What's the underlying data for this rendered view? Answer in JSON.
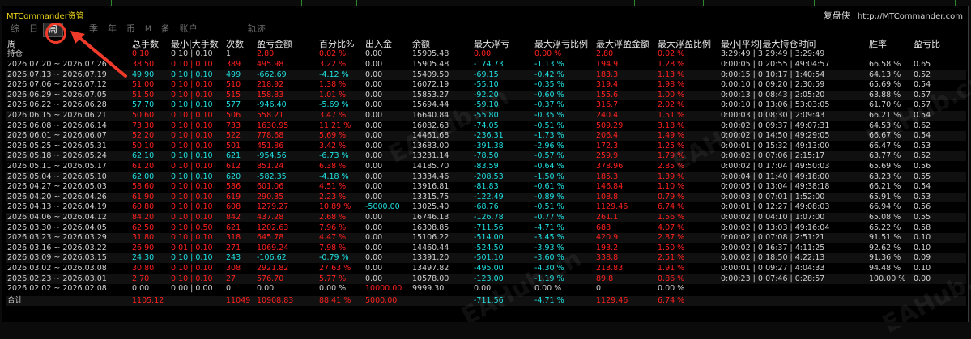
{
  "app": {
    "title": "MTCommander资管",
    "brand_cn": "复盘侠",
    "brand_url": "http://MTCommander.com"
  },
  "tabs": [
    {
      "label": "综",
      "active": false
    },
    {
      "label": "日",
      "active": false
    },
    {
      "label": "周",
      "active": true
    },
    {
      "label": "季",
      "active": false
    },
    {
      "label": "年",
      "active": false
    },
    {
      "label": "币",
      "active": false
    },
    {
      "label": "M",
      "active": false
    },
    {
      "label": "备",
      "active": false
    },
    {
      "label": "账户",
      "active": false
    },
    {
      "label": "轨迹",
      "active": false
    }
  ],
  "columns": [
    "周",
    "总手数",
    "最小|大手数",
    "次数",
    "盈亏金额",
    "百分比%",
    "出入金",
    "余额",
    "最大浮亏",
    "最大浮亏比例",
    "最大浮盈金额",
    "最大浮盈比例",
    "最小|平均|最大持仓时间",
    "胜率",
    "盈亏比"
  ],
  "holding_row": [
    "持仓",
    "0.10",
    "0.10 | 0.10",
    "1",
    "2.80",
    "0.02 %",
    "0.00",
    "15905.48",
    "0.00",
    "0.00 %",
    "2.80",
    "0.02 %",
    "3:29:49 | 3:29:49 | 3:29:49",
    "",
    ""
  ],
  "rows": [
    [
      "2026.07.20 ~ 2026.07.26",
      "38.50",
      "0.10 | 0.10",
      "389",
      "495.98",
      "3.22 %",
      "0.00",
      "15905.48",
      "-174.73",
      "-1.13 %",
      "194.9",
      "1.28 %",
      "0:00:05 | 0:20:55 | 49:04:57",
      "66.58 %",
      "0.65"
    ],
    [
      "2026.07.13 ~ 2026.07.19",
      "49.90",
      "0.10 | 0.10",
      "499",
      "-662.69",
      "-4.12 %",
      "0.00",
      "15409.50",
      "-69.15",
      "-0.42 %",
      "183.3",
      "1.13 %",
      "0:00:15 | 0:10:17 | 1:40:54",
      "64.13 %",
      "0.52"
    ],
    [
      "2026.07.06 ~ 2026.07.12",
      "51.00",
      "0.10 | 0.10",
      "510",
      "218.92",
      "1.38 %",
      "0.00",
      "16072.19",
      "-55.10",
      "-0.35 %",
      "319.4",
      "1.98 %",
      "0:00:10 | 0:09:20 | 2:30:59",
      "65.69 %",
      "0.54"
    ],
    [
      "2026.06.29 ~ 2026.07.05",
      "51.50",
      "0.10 | 0.10",
      "515",
      "158.83",
      "1.01 %",
      "0.00",
      "15853.27",
      "-92.20",
      "-0.60 %",
      "155.6",
      "1.00 %",
      "0:00:13 | 0:08:43 | 2:05:20",
      "63.88 %",
      "0.57"
    ],
    [
      "2026.06.22 ~ 2026.06.28",
      "57.70",
      "0.10 | 0.10",
      "577",
      "-946.40",
      "-5.69 %",
      "0.00",
      "15694.44",
      "-59.10",
      "-0.37 %",
      "316.7",
      "2.02 %",
      "0:00:10 | 0:13:06 | 53:03:05",
      "61.70 %",
      "0.57"
    ],
    [
      "2026.06.15 ~ 2026.06.21",
      "50.60",
      "0.10 | 0.10",
      "506",
      "558.21",
      "3.47 %",
      "0.00",
      "16640.84",
      "-55.80",
      "-0.35 %",
      "240.4",
      "1.51 %",
      "0:00:03 | 0:08:30 | 2:09:43",
      "66.21 %",
      "0.54"
    ],
    [
      "2026.06.08 ~ 2026.06.14",
      "73.30",
      "0.10 | 0.10",
      "733",
      "1630.95",
      "11.21 %",
      "0.00",
      "16082.63",
      "-74.05",
      "-0.51 %",
      "509.29",
      "3.18 %",
      "0:00:02 | 0:09:37 | 49:07:31",
      "64.53 %",
      "0.62"
    ],
    [
      "2026.06.01 ~ 2026.06.07",
      "52.20",
      "0.10 | 0.10",
      "522",
      "778.68",
      "5.69 %",
      "0.00",
      "14461.68",
      "-236.31",
      "-1.73 %",
      "206.4",
      "1.49 %",
      "0:00:02 | 0:14:50 | 49:29:05",
      "66.67 %",
      "0.54"
    ],
    [
      "2026.05.25 ~ 2026.05.31",
      "50.10",
      "0.10 | 0.10",
      "501",
      "451.86",
      "3.42 %",
      "0.00",
      "13683.00",
      "-391.38",
      "-2.96 %",
      "172.3",
      "1.25 %",
      "0:00:01 | 0:15:32 | 49:13:00",
      "66.47 %",
      "0.53"
    ],
    [
      "2026.05.18 ~ 2026.05.24",
      "62.10",
      "0.10 | 0.10",
      "621",
      "-954.56",
      "-6.73 %",
      "0.00",
      "13231.14",
      "-78.50",
      "-0.57 %",
      "259.9",
      "1.79 %",
      "0:00:02 | 0:07:06 | 2:15:17",
      "63.77 %",
      "0.52"
    ],
    [
      "2026.05.11 ~ 2026.05.17",
      "61.20",
      "0.10 | 0.10",
      "612",
      "851.24",
      "6.38 %",
      "0.00",
      "14185.70",
      "-83.59",
      "-0.64 %",
      "378.96",
      "2.85 %",
      "0:00:02 | 0:17:04 | 49:50:03",
      "65.69 %",
      "0.56"
    ],
    [
      "2026.05.04 ~ 2026.05.10",
      "62.00",
      "0.10 | 0.10",
      "620",
      "-582.35",
      "-4.18 %",
      "0.00",
      "13334.46",
      "-208.53",
      "-1.50 %",
      "185.3",
      "1.39 %",
      "0:00:04 | 0:11:40 | 49:18:00",
      "63.23 %",
      "0.55"
    ],
    [
      "2026.04.27 ~ 2026.05.03",
      "58.60",
      "0.10 | 0.10",
      "586",
      "601.06",
      "4.51 %",
      "0.00",
      "13916.81",
      "-81.83",
      "-0.61 %",
      "146.84",
      "1.10 %",
      "0:00:05 | 0:13:04 | 49:38:18",
      "66.21 %",
      "0.54"
    ],
    [
      "2026.04.20 ~ 2026.04.26",
      "61.90",
      "0.10 | 0.10",
      "619",
      "290.35",
      "2.23 %",
      "0.00",
      "13315.75",
      "-122.49",
      "-0.89 %",
      "108.8",
      "0.79 %",
      "0:00:03 | 0:07:01 | 1:52:00",
      "65.91 %",
      "0.53"
    ],
    [
      "2026.04.13 ~ 2026.04.19",
      "60.80",
      "0.10 | 0.10",
      "608",
      "1279.27",
      "10.89 %",
      "-5000.00",
      "13025.40",
      "-68.76",
      "-0.51 %",
      "1129.46",
      "6.74 %",
      "0:00:01 | 0:12:27 | 49:08:03",
      "66.94 %",
      "0.56"
    ],
    [
      "2026.04.06 ~ 2026.04.12",
      "84.20",
      "0.10 | 0.10",
      "842",
      "437.28",
      "2.68 %",
      "0.00",
      "16746.13",
      "-126.78",
      "-0.77 %",
      "261.1",
      "1.56 %",
      "0:00:02 | 0:04:10 | 1:07:00",
      "65.08 %",
      "0.55"
    ],
    [
      "2026.03.30 ~ 2026.04.05",
      "62.50",
      "0.10 | 0.50",
      "621",
      "1202.63",
      "7.96 %",
      "0.00",
      "16308.85",
      "-711.56",
      "-4.71 %",
      "688",
      "4.07 %",
      "0:00:02 | 0:13:03 | 49:16:04",
      "65.22 %",
      "0.58"
    ],
    [
      "2026.03.23 ~ 2026.03.29",
      "31.80",
      "0.10 | 0.10",
      "318",
      "645.78",
      "4.47 %",
      "0.00",
      "15106.22",
      "-514.00",
      "-3.45 %",
      "420.9",
      "2.87 %",
      "0:00:02 | 0:07:08 | 2:51:21",
      "91.51 %",
      "0.10"
    ],
    [
      "2026.03.16 ~ 2026.03.22",
      "26.90",
      "0.01 | 0.10",
      "271",
      "1069.24",
      "7.98 %",
      "0.00",
      "14460.44",
      "-524.50",
      "-3.93 %",
      "193.2",
      "1.50 %",
      "0:00:02 | 0:16:37 | 4:11:25",
      "92.62 %",
      "0.10"
    ],
    [
      "2026.03.09 ~ 2026.03.15",
      "24.30",
      "0.10 | 0.10",
      "243",
      "-106.62",
      "-0.79 %",
      "0.00",
      "13391.20",
      "-501.10",
      "-3.60 %",
      "338.8",
      "2.51 %",
      "0:00:02 | 0:18:50 | 4:22:13",
      "91.36 %",
      "0.09"
    ],
    [
      "2026.03.02 ~ 2026.03.08",
      "30.80",
      "0.10 | 0.10",
      "308",
      "2921.82",
      "27.63 %",
      "0.00",
      "13497.82",
      "-495.00",
      "-4.30 %",
      "213.83",
      "1.91 %",
      "0:00:01 | 0:09:27 | 4:04:33",
      "94.48 %",
      "0.10"
    ],
    [
      "2026.02.23 ~ 2026.03.01",
      "2.70",
      "0.10 | 0.10",
      "27",
      "576.70",
      "5.77 %",
      "0.00",
      "10578.00",
      "-123.00",
      "-1.19 %",
      "89.8",
      "0.86 %",
      "0:00:23 | 0:07:46 | 0:28:57",
      "100.00 %",
      "0.00"
    ],
    [
      "2026.02.02 ~ 2026.02.08",
      "0.00",
      "0.00 | 0.00",
      "0",
      "0.00",
      "0.00 %",
      "10000.00",
      "9999.30",
      "0.00",
      "0.00 %",
      "0",
      "0.00 %",
      "",
      "",
      ""
    ]
  ],
  "footer_row": [
    "合计",
    "1105.12",
    "",
    "11049",
    "10908.83",
    "88.41 %",
    "5000.00",
    "",
    "-711.56",
    "-4.71 %",
    "1129.46",
    "6.74 %",
    "",
    "",
    ""
  ],
  "colors": {
    "profit": "#ff2020",
    "loss": "#20e0e0",
    "title": "#e8d21c",
    "annotation": "#f03a2a"
  }
}
